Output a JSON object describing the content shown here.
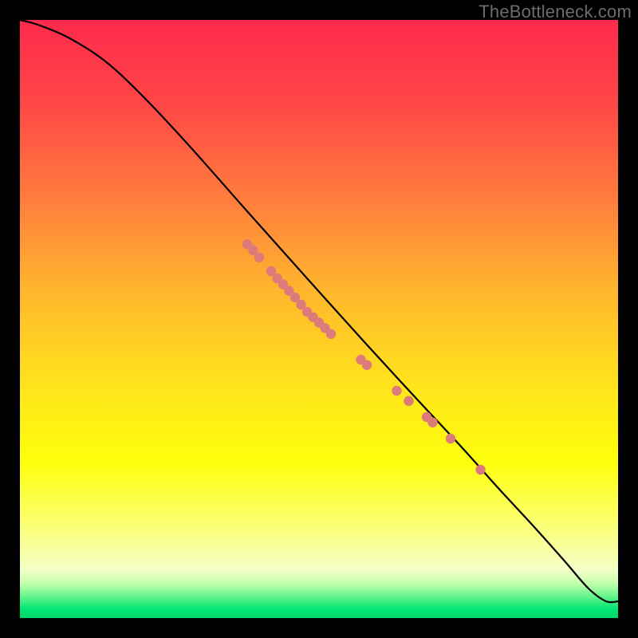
{
  "watermark": "TheBottleneck.com",
  "colors": {
    "gradient_stops": [
      {
        "offset": 0.0,
        "color": "#ff2a4d"
      },
      {
        "offset": 0.14,
        "color": "#ff4747"
      },
      {
        "offset": 0.3,
        "color": "#ff7d3d"
      },
      {
        "offset": 0.45,
        "color": "#ffb52d"
      },
      {
        "offset": 0.6,
        "color": "#ffe11d"
      },
      {
        "offset": 0.74,
        "color": "#feff0c"
      },
      {
        "offset": 0.86,
        "color": "#faff84"
      },
      {
        "offset": 0.92,
        "color": "#f4ffca"
      },
      {
        "offset": 0.945,
        "color": "#b9ffa7"
      },
      {
        "offset": 0.965,
        "color": "#5ff38b"
      },
      {
        "offset": 0.985,
        "color": "#00e673"
      },
      {
        "offset": 1.0,
        "color": "#00d96a"
      }
    ],
    "line": "#000000",
    "marker": "#dd7b7b"
  },
  "chart_data": {
    "type": "line",
    "title": "",
    "xlabel": "",
    "ylabel": "",
    "xlim": [
      0,
      100
    ],
    "ylim": [
      0,
      100
    ],
    "grid": false,
    "legend": "none",
    "series": [
      {
        "name": "curve",
        "x": [
          0,
          3,
          8,
          14,
          20,
          28,
          38,
          48,
          58,
          66,
          74,
          80,
          86,
          91,
          95,
          98,
          100
        ],
        "values": [
          100.0,
          99.2,
          97.1,
          93.3,
          87.8,
          79.3,
          68.0,
          56.8,
          45.7,
          37.0,
          28.4,
          21.7,
          15.2,
          9.6,
          5.0,
          2.8,
          2.8
        ]
      }
    ],
    "markers": [
      {
        "x": 38,
        "y": 62.5
      },
      {
        "x": 39,
        "y": 61.5
      },
      {
        "x": 40,
        "y": 60.3
      },
      {
        "x": 42,
        "y": 58.0
      },
      {
        "x": 43,
        "y": 56.8
      },
      {
        "x": 44,
        "y": 55.8
      },
      {
        "x": 45,
        "y": 54.7
      },
      {
        "x": 46,
        "y": 53.6
      },
      {
        "x": 47,
        "y": 52.4
      },
      {
        "x": 48,
        "y": 51.2
      },
      {
        "x": 49,
        "y": 50.3
      },
      {
        "x": 50,
        "y": 49.4
      },
      {
        "x": 51,
        "y": 48.5
      },
      {
        "x": 52,
        "y": 47.5
      },
      {
        "x": 57,
        "y": 43.2
      },
      {
        "x": 58,
        "y": 42.3
      },
      {
        "x": 63,
        "y": 38.0
      },
      {
        "x": 65,
        "y": 36.3
      },
      {
        "x": 68,
        "y": 33.6
      },
      {
        "x": 69,
        "y": 32.7
      },
      {
        "x": 72,
        "y": 30.0
      },
      {
        "x": 77,
        "y": 24.8
      }
    ]
  }
}
